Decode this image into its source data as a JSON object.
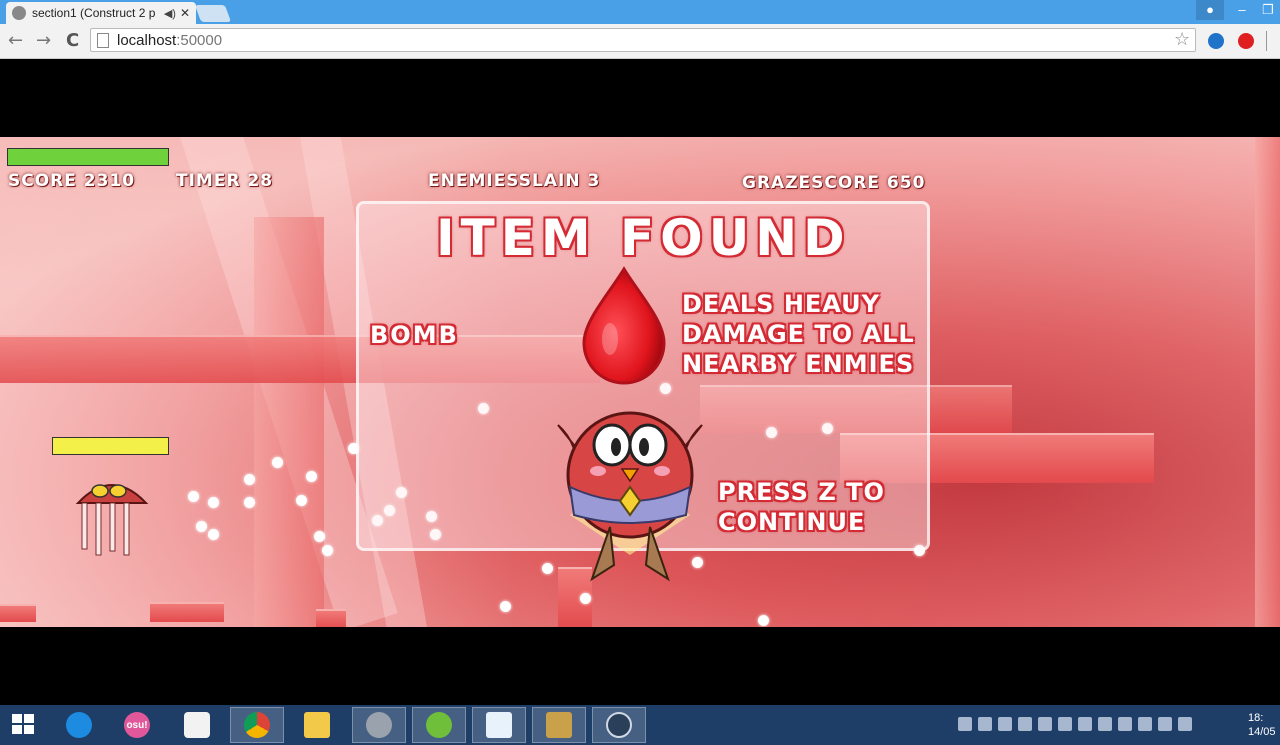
{
  "browser": {
    "tab_title": "section1 (Construct 2 p",
    "tab_sound_icon": "speaker-icon",
    "tab_close": "✕",
    "address_host": "localhost",
    "address_port": ":50000",
    "back": "←",
    "forward": "→",
    "reload": "C",
    "star": "☆",
    "win_min": "–",
    "win_max": "❐",
    "win_user": "👤"
  },
  "game": {
    "hud": {
      "score": "SCORE 2310",
      "timer": "TIMER 28",
      "enemies_slain": "ENEMIESSLAIN 3",
      "graze_score": "GRAZESCORE 650"
    },
    "player_health_fraction": 1.0,
    "enemy_health_fraction": 1.0,
    "colors": {
      "player_health": "#6fd13b",
      "enemy_health": "#f4f04a",
      "text_outline": "#d42a34"
    },
    "dialog": {
      "title": "ITEM FOUND",
      "item_name": "BOMB",
      "item_desc_line1": "DEALS HEAUY",
      "item_desc_line2": "DAMAGE TO ALL",
      "item_desc_line3": "NEARBY ENMIES",
      "prompt_line1": "PRESS Z TO",
      "prompt_line2": "CONTINUE"
    }
  },
  "taskbar": {
    "apps": [
      "internet-explorer-icon",
      "osu-icon",
      "apps-grid-icon",
      "chrome-icon",
      "file-explorer-icon",
      "settings-icon",
      "paint-icon",
      "feather-icon",
      "league-of-legends-icon",
      "steam-icon"
    ],
    "osu_label": "osu!",
    "clock_time": "18:",
    "clock_date": "14/05"
  }
}
